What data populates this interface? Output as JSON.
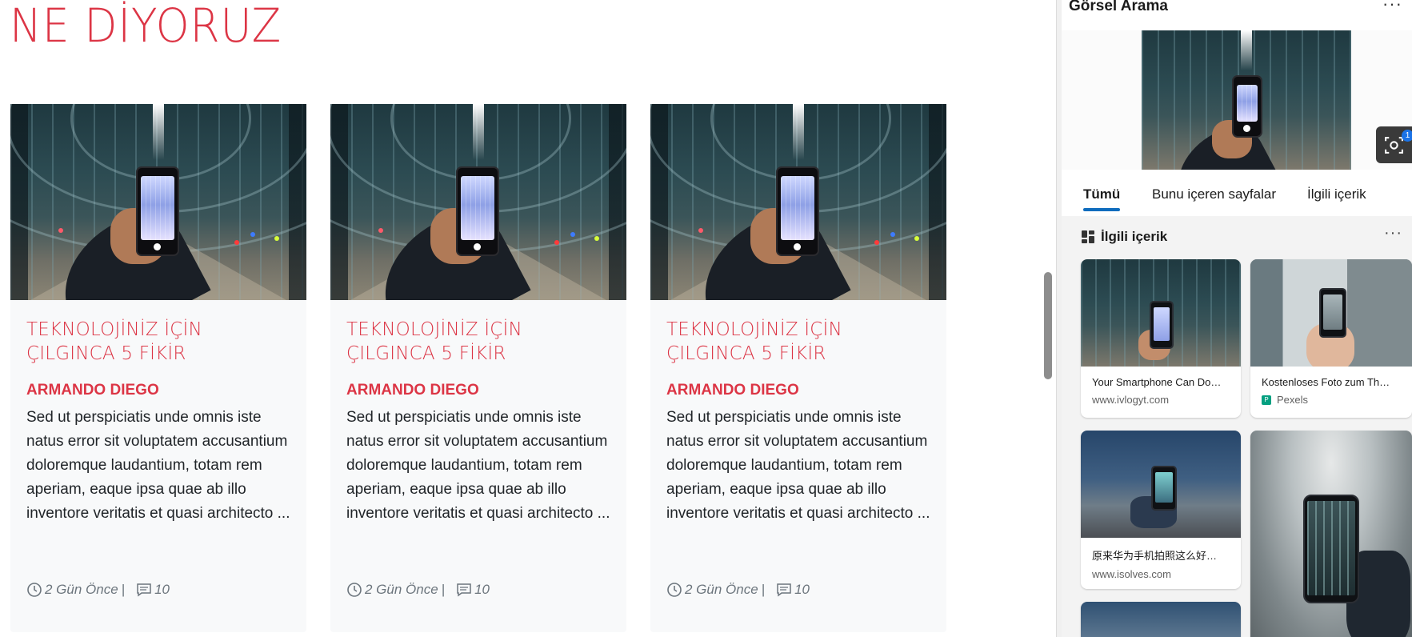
{
  "page": {
    "title": "NE DİYORUZ"
  },
  "posts": [
    {
      "title": "TEKNOLOJİNİZ İÇİN ÇILGINCA 5 FİKİR",
      "author": "ARMANDO DIEGO",
      "excerpt": "Sed ut perspiciatis unde omnis iste natus error sit voluptatem accusantium doloremque laudantium, totam rem aperiam, eaque ipsa quae ab illo inventore veritatis et quasi architecto ...",
      "time": "2 Gün Önce",
      "separator": "|",
      "comments": "10"
    },
    {
      "title": "TEKNOLOJİNİZ İÇİN ÇILGINCA 5 FİKİR",
      "author": "ARMANDO DIEGO",
      "excerpt": "Sed ut perspiciatis unde omnis iste natus error sit voluptatem accusantium doloremque laudantium, totam rem aperiam, eaque ipsa quae ab illo inventore veritatis et quasi architecto ...",
      "time": "2 Gün Önce",
      "separator": "|",
      "comments": "10"
    },
    {
      "title": "TEKNOLOJİNİZ İÇİN ÇILGINCA 5 FİKİR",
      "author": "ARMANDO DIEGO",
      "excerpt": "Sed ut perspiciatis unde omnis iste natus error sit voluptatem accusantium doloremque laudantium, totam rem aperiam, eaque ipsa quae ab illo inventore veritatis et quasi architecto ...",
      "time": "2 Gün Önce",
      "separator": "|",
      "comments": "10"
    }
  ],
  "panel": {
    "title": "Görsel Arama",
    "more": "···",
    "lens_badge": "1",
    "tabs": [
      {
        "label": "Tümü",
        "active": true
      },
      {
        "label": "Bunu içeren sayfalar",
        "active": false
      },
      {
        "label": "İlgili içerik",
        "active": false
      }
    ],
    "section": {
      "title": "İlgili içerik",
      "more": "···"
    },
    "results": [
      {
        "title": "Your Smartphone Can Do…",
        "source": "www.ivlogyt.com"
      },
      {
        "title": "Kostenloses Foto zum Th…",
        "source": "Pexels",
        "source_icon": "pexels-icon"
      },
      {
        "title": "原来华为手机拍照这么好…",
        "source": "www.isolves.com"
      }
    ]
  },
  "colors": {
    "accent": "#dc3545",
    "tab_active": "#0f6cbd",
    "card_bg": "#f8f9fa"
  },
  "icons": {
    "time": "clock-icon",
    "comments": "comment-icon",
    "section": "grid-icon",
    "lens": "visual-search-icon"
  }
}
